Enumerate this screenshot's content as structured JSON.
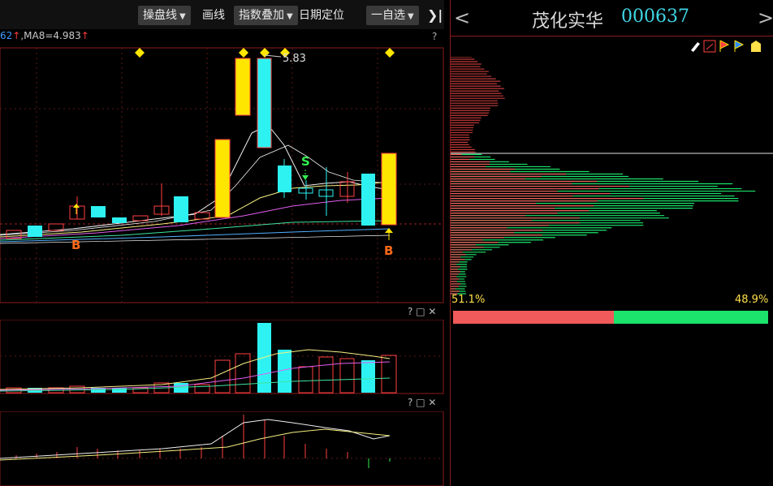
{
  "toolbar": {
    "draw_line_tool": "操盘线",
    "draw": "画线",
    "index_overlay": "指数叠加",
    "date_locate": "日期定位",
    "watchlist": "一自选",
    "collapse_glyph": "❯|"
  },
  "indicator_line": {
    "prefix": "62",
    "ma8_label": "MA8=4.983",
    "arrow": "↑"
  },
  "main_chart": {
    "high_label": "5.83",
    "signal_s": "S",
    "signal_b": "B",
    "help": "?"
  },
  "sub_panel_controls": {
    "help": "?",
    "max": "□",
    "close": "✕"
  },
  "right_panel": {
    "stock_name": "茂化实华",
    "stock_code": "000637",
    "prev": "<",
    "next": ">",
    "profit_pct": "51.1%",
    "loss_pct": "48.9%",
    "profit_ratio": 0.511,
    "colors": {
      "profit": "#f05a5a",
      "loss": "#1be36b"
    }
  },
  "colors": {
    "rise": "#ff4040",
    "fall": "#2ef2f2",
    "highlight": "#ffe600",
    "frame": "#8a1c1c"
  }
}
